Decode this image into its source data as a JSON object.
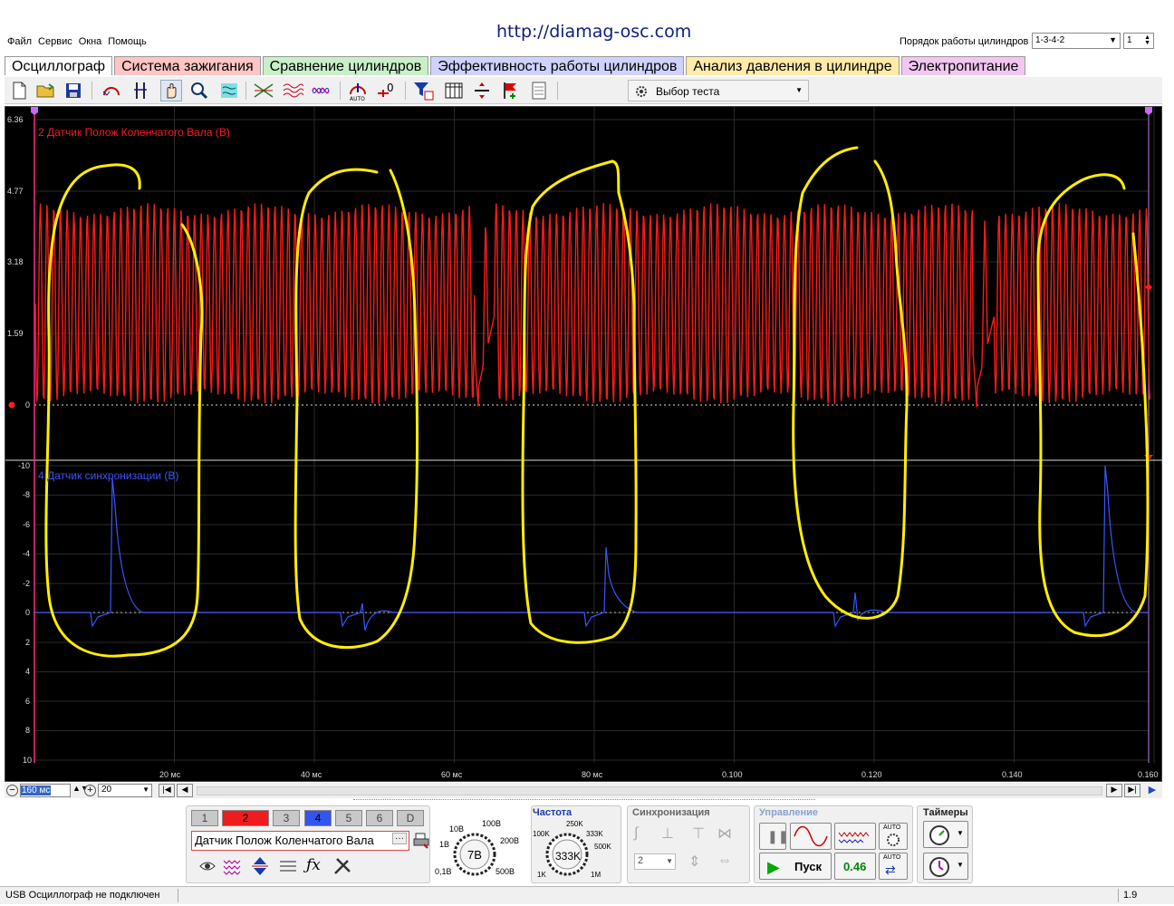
{
  "url": "http://diamag-osc.com",
  "menu": [
    "Файл",
    "Сервис",
    "Окна",
    "Помощь"
  ],
  "cylinder_order": {
    "label": "Порядок работы цилиндров",
    "value": "1-3-4-2",
    "stepper": "1"
  },
  "tabs": [
    {
      "label": "Осциллограф",
      "color": "#ffffff"
    },
    {
      "label": "Система зажигания",
      "color": "#ffc4c4"
    },
    {
      "label": "Сравнение цилиндров",
      "color": "#c8f0c8"
    },
    {
      "label": "Эффективность работы цилиндров",
      "color": "#cfd2ff"
    },
    {
      "label": "Анализ давления в цилиндре",
      "color": "#ffeaa8"
    },
    {
      "label": "Электропитание",
      "color": "#f2c6f2"
    }
  ],
  "toolbar": {
    "test_select": "Выбор теста",
    "icons": [
      "new-file-icon",
      "open-folder-icon",
      "save-icon",
      "cursor-mode-icon",
      "vertical-cursors-icon",
      "hand-icon",
      "zoom-icon",
      "filter-icon",
      "waveform-a-icon",
      "waveform-b-icon",
      "waveform-c-icon",
      "auto-scale-icon",
      "zero-icon",
      "channel-filter-icon",
      "table-icon",
      "split-icon",
      "marker-flag-icon",
      "notes-icon"
    ]
  },
  "scope": {
    "channel_top": {
      "title": "2 Датчик Полож Коленчатого Вала (В)",
      "color": "#ff1a1a",
      "y_ticks": [
        "6.36",
        "4.77",
        "3.18",
        "1.59",
        "0"
      ]
    },
    "channel_bottom": {
      "title": "4 Датчик синхронизации (В)",
      "color": "#3a55ff",
      "y_ticks": [
        "-10",
        "-8",
        "-6",
        "-4",
        "-2",
        "0",
        "2",
        "4",
        "6",
        "8",
        "10"
      ]
    },
    "x_ticks": [
      "20 мс",
      "40 мс",
      "60 мс",
      "80 мс",
      "0.100",
      "0.120",
      "0.140",
      "0.160"
    ],
    "marker_top_left": "2",
    "marker_top_right": "2"
  },
  "bottom_nav": {
    "timebase": "160 мс",
    "samples": "20"
  },
  "channels": [
    "1",
    "2",
    "3",
    "4",
    "5",
    "6",
    "D"
  ],
  "channel_name": "Датчик Полож Коленчатого Вала",
  "voltage_dial": {
    "value": "7В",
    "labels": [
      "10В",
      "100В",
      "200В",
      "500В",
      "0,1В",
      "1В"
    ]
  },
  "frequency": {
    "title": "Частота",
    "value": "333K",
    "labels": [
      "250K",
      "333K",
      "500K",
      "1M",
      "1K",
      "100K"
    ]
  },
  "sync": {
    "title": "Синхронизация",
    "value": "2"
  },
  "control": {
    "title": "Управление",
    "start": "Пуск",
    "value": "0.46",
    "auto1": "AUTO",
    "auto2": "AUTO"
  },
  "timers": {
    "title": "Таймеры"
  },
  "status": {
    "left": "USB Осциллограф не подключен",
    "right": "1.9"
  },
  "colors": {
    "annotation": "#ffee00",
    "grid": "#2a2a2a"
  }
}
